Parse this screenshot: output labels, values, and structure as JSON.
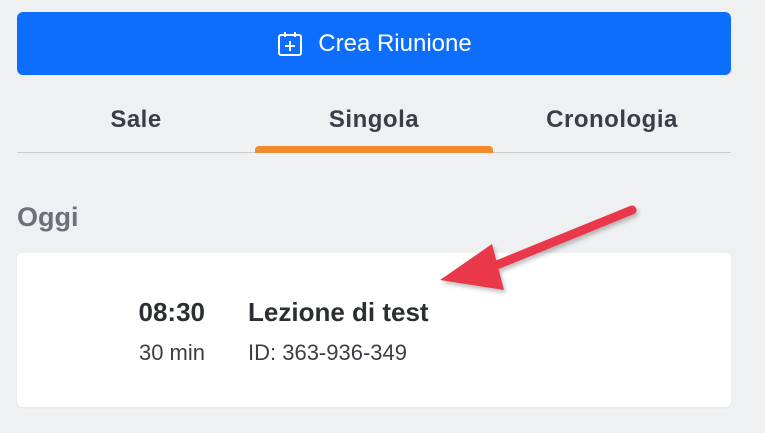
{
  "create_button": {
    "label": "Crea Riunione",
    "icon": "calendar-add-icon"
  },
  "tabs": [
    {
      "label": "Sale",
      "active": false
    },
    {
      "label": "Singola",
      "active": true
    },
    {
      "label": "Cronologia",
      "active": false
    }
  ],
  "section": {
    "title": "Oggi"
  },
  "meetings": [
    {
      "time": "08:30",
      "duration": "30 min",
      "title": "Lezione di test",
      "id_text": "ID: 363-936-349"
    }
  ],
  "colors": {
    "primary": "#0d6efd",
    "tab_active_underline": "#f08c2e",
    "annotation_arrow": "#e8394a"
  }
}
